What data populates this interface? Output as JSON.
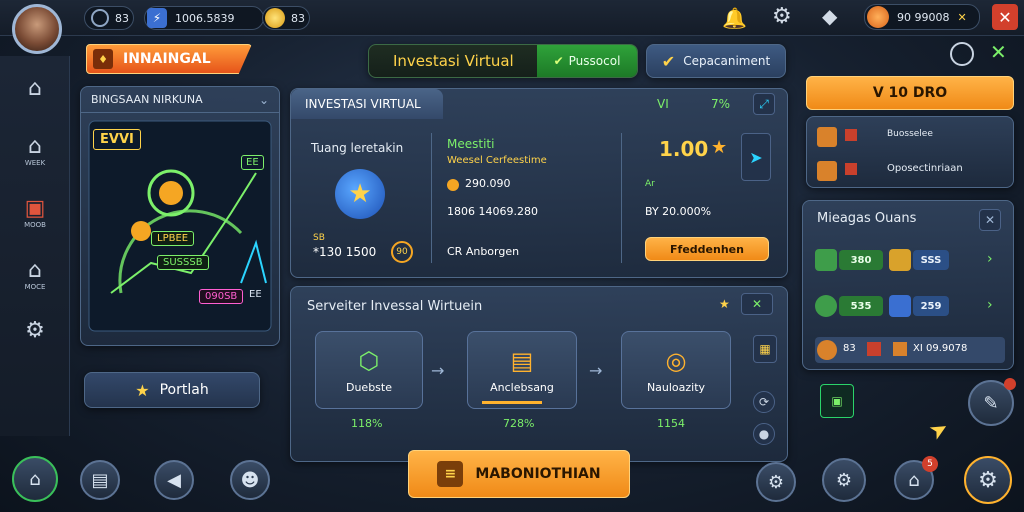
{
  "topbar": {
    "stat_a": "83",
    "stat_b_value": "1006.5839",
    "stat_c": "83",
    "currency_value": "90 99008"
  },
  "sidebar": {
    "items": [
      {
        "label": "",
        "icon": "home-icon"
      },
      {
        "label": "WEEK",
        "icon": "house-icon"
      },
      {
        "label": "MOOB",
        "icon": "bag-icon"
      },
      {
        "label": "MOCE",
        "icon": "house-icon"
      },
      {
        "label": "",
        "icon": "settings-icon"
      }
    ]
  },
  "left": {
    "banner": "INNAINGAL",
    "panel_title": "BINGSAAN NIRKUNA",
    "chart_tag_a": "EVVI",
    "chart_tag_b": "EE",
    "chart_label_1": "LPBEE",
    "chart_label_2": "SUSSSB",
    "chart_label_3": "090SB",
    "chart_label_4": "EE",
    "portal_button": "Portlah"
  },
  "header": {
    "title": "Investasi Virtual",
    "status": "Pussocol",
    "action": "Cepacaniment"
  },
  "main_panel": {
    "tab": "INVESTASI VIRTUAL",
    "stat_1": "VI",
    "stat_2": "7%",
    "left_label": "Tuang leretakin",
    "left_value_small": "SB",
    "left_value": "*130 1500",
    "left_value_side": "90",
    "mid_title": "Meestiti",
    "mid_sub": "Weesel Cerfeestime",
    "mid_val_1": "290.090",
    "mid_val_2": "1806 14069.280",
    "mid_val_3": "CR Anborgen",
    "right_value": "1.00",
    "right_small": "Ar",
    "right_pct": "BY 20.000%",
    "right_button": "Ffeddenhen"
  },
  "flow_panel": {
    "title": "Serveiter Invessal Wirtuein",
    "steps": [
      {
        "label": "Duebste",
        "pct": "118%"
      },
      {
        "label": "Anclebsang",
        "pct": "728%"
      },
      {
        "label": "Nauloazity",
        "pct": "1154"
      }
    ],
    "confirm_button": "MABONIOTHIAN"
  },
  "right": {
    "top_button": "V 10 DRO",
    "info_1": "Buosselee",
    "info_2": "Oposectinriaan",
    "list_title": "Mieagas Ouans",
    "rows": [
      {
        "a": "380",
        "b": "SSS"
      },
      {
        "a": "535",
        "b": "259"
      },
      {
        "a": "83",
        "b": "XI 09.9078"
      }
    ]
  },
  "bottom": {
    "notif_count": "5"
  },
  "colors": {
    "accent_orange": "#f5a623",
    "accent_green": "#7cf06a",
    "panel_bg": "#2a3a52"
  }
}
